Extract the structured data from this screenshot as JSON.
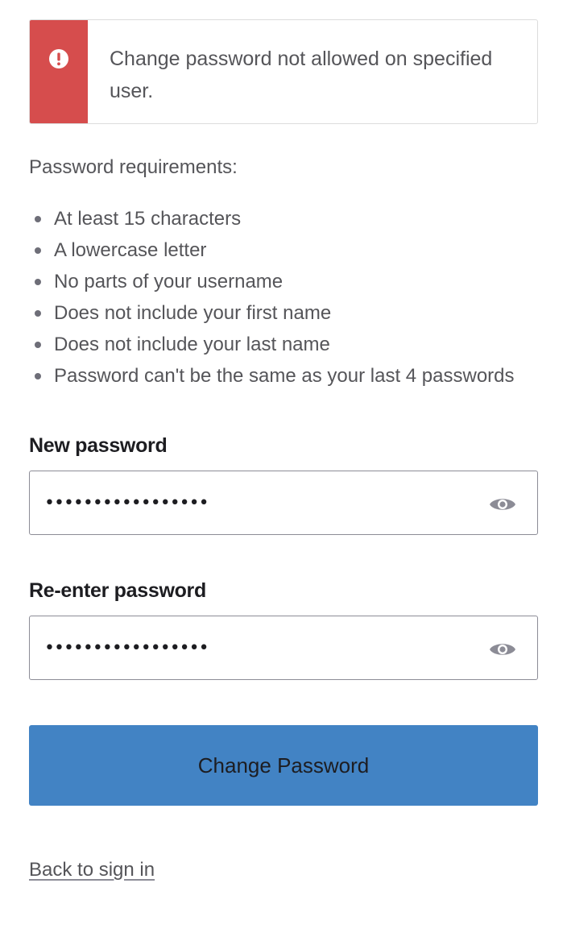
{
  "alert": {
    "message": "Change password not allowed on specified user.",
    "icon": "error-icon",
    "color": "#d64d4d"
  },
  "requirements": {
    "title": "Password requirements:",
    "items": [
      "At least 15 characters",
      "A lowercase letter",
      "No parts of your username",
      "Does not include your first name",
      "Does not include your last name",
      "Password can't be the same as your last 4 passwords"
    ]
  },
  "form": {
    "new_password": {
      "label": "New password",
      "value": "•••••••••••••••••",
      "toggle_icon": "eye-icon"
    },
    "reenter_password": {
      "label": "Re-enter password",
      "value": "•••••••••••••••••",
      "toggle_icon": "eye-icon"
    },
    "submit_label": "Change Password",
    "submit_color": "#4283c4"
  },
  "footer": {
    "back_link": "Back to sign in"
  }
}
